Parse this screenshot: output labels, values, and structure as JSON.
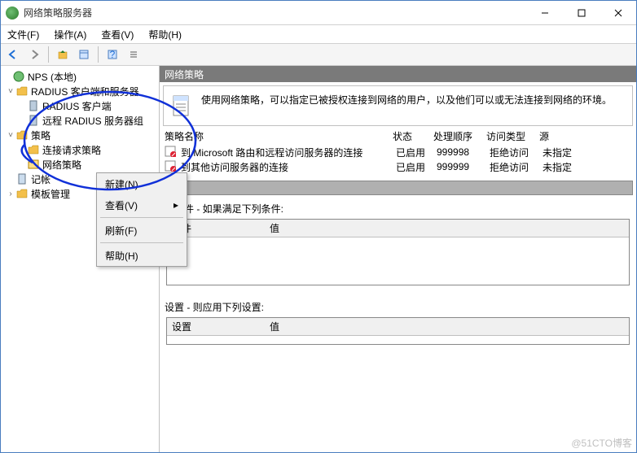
{
  "window": {
    "title": "网络策略服务器",
    "minimize": "–",
    "maximize": "☐",
    "close": "✕"
  },
  "menu": {
    "file": "文件(F)",
    "action": "操作(A)",
    "view": "查看(V)",
    "help": "帮助(H)"
  },
  "tree": {
    "root": "NPS (本地)",
    "radius": "RADIUS 客户端和服务器",
    "radius_client": "RADIUS 客户端",
    "radius_remote": "远程 RADIUS 服务器组",
    "policy": "策略",
    "conn_req": "连接请求策略",
    "net_policy": "网络策略",
    "accounting": "记帐",
    "template": "模板管理"
  },
  "context_menu": {
    "new": "新建(N)",
    "view": "查看(V)",
    "refresh": "刷新(F)",
    "help": "帮助(H)"
  },
  "right": {
    "header": "网络策略",
    "info": "使用网络策略，可以指定已被授权连接到网络的用户，以及他们可以或无法连接到网络的环境。",
    "columns": {
      "name": "策略名称",
      "status": "状态",
      "order": "处理顺序",
      "access": "访问类型",
      "source": "源"
    },
    "rows": [
      {
        "name": "到 Microsoft 路由和远程访问服务器的连接",
        "status": "已启用",
        "order": "999998",
        "access": "拒绝访问",
        "source": "未指定"
      },
      {
        "name": "到其他访问服务器的连接",
        "status": "已启用",
        "order": "999999",
        "access": "拒绝访问",
        "source": "未指定"
      }
    ],
    "cond_title": "条件 - 如果满足下列条件:",
    "cond_cols": {
      "cond": "条件",
      "val": "值"
    },
    "set_title": "设置 - 则应用下列设置:",
    "set_cols": {
      "set": "设置",
      "val": "值"
    }
  },
  "watermark": "@51CTO博客"
}
